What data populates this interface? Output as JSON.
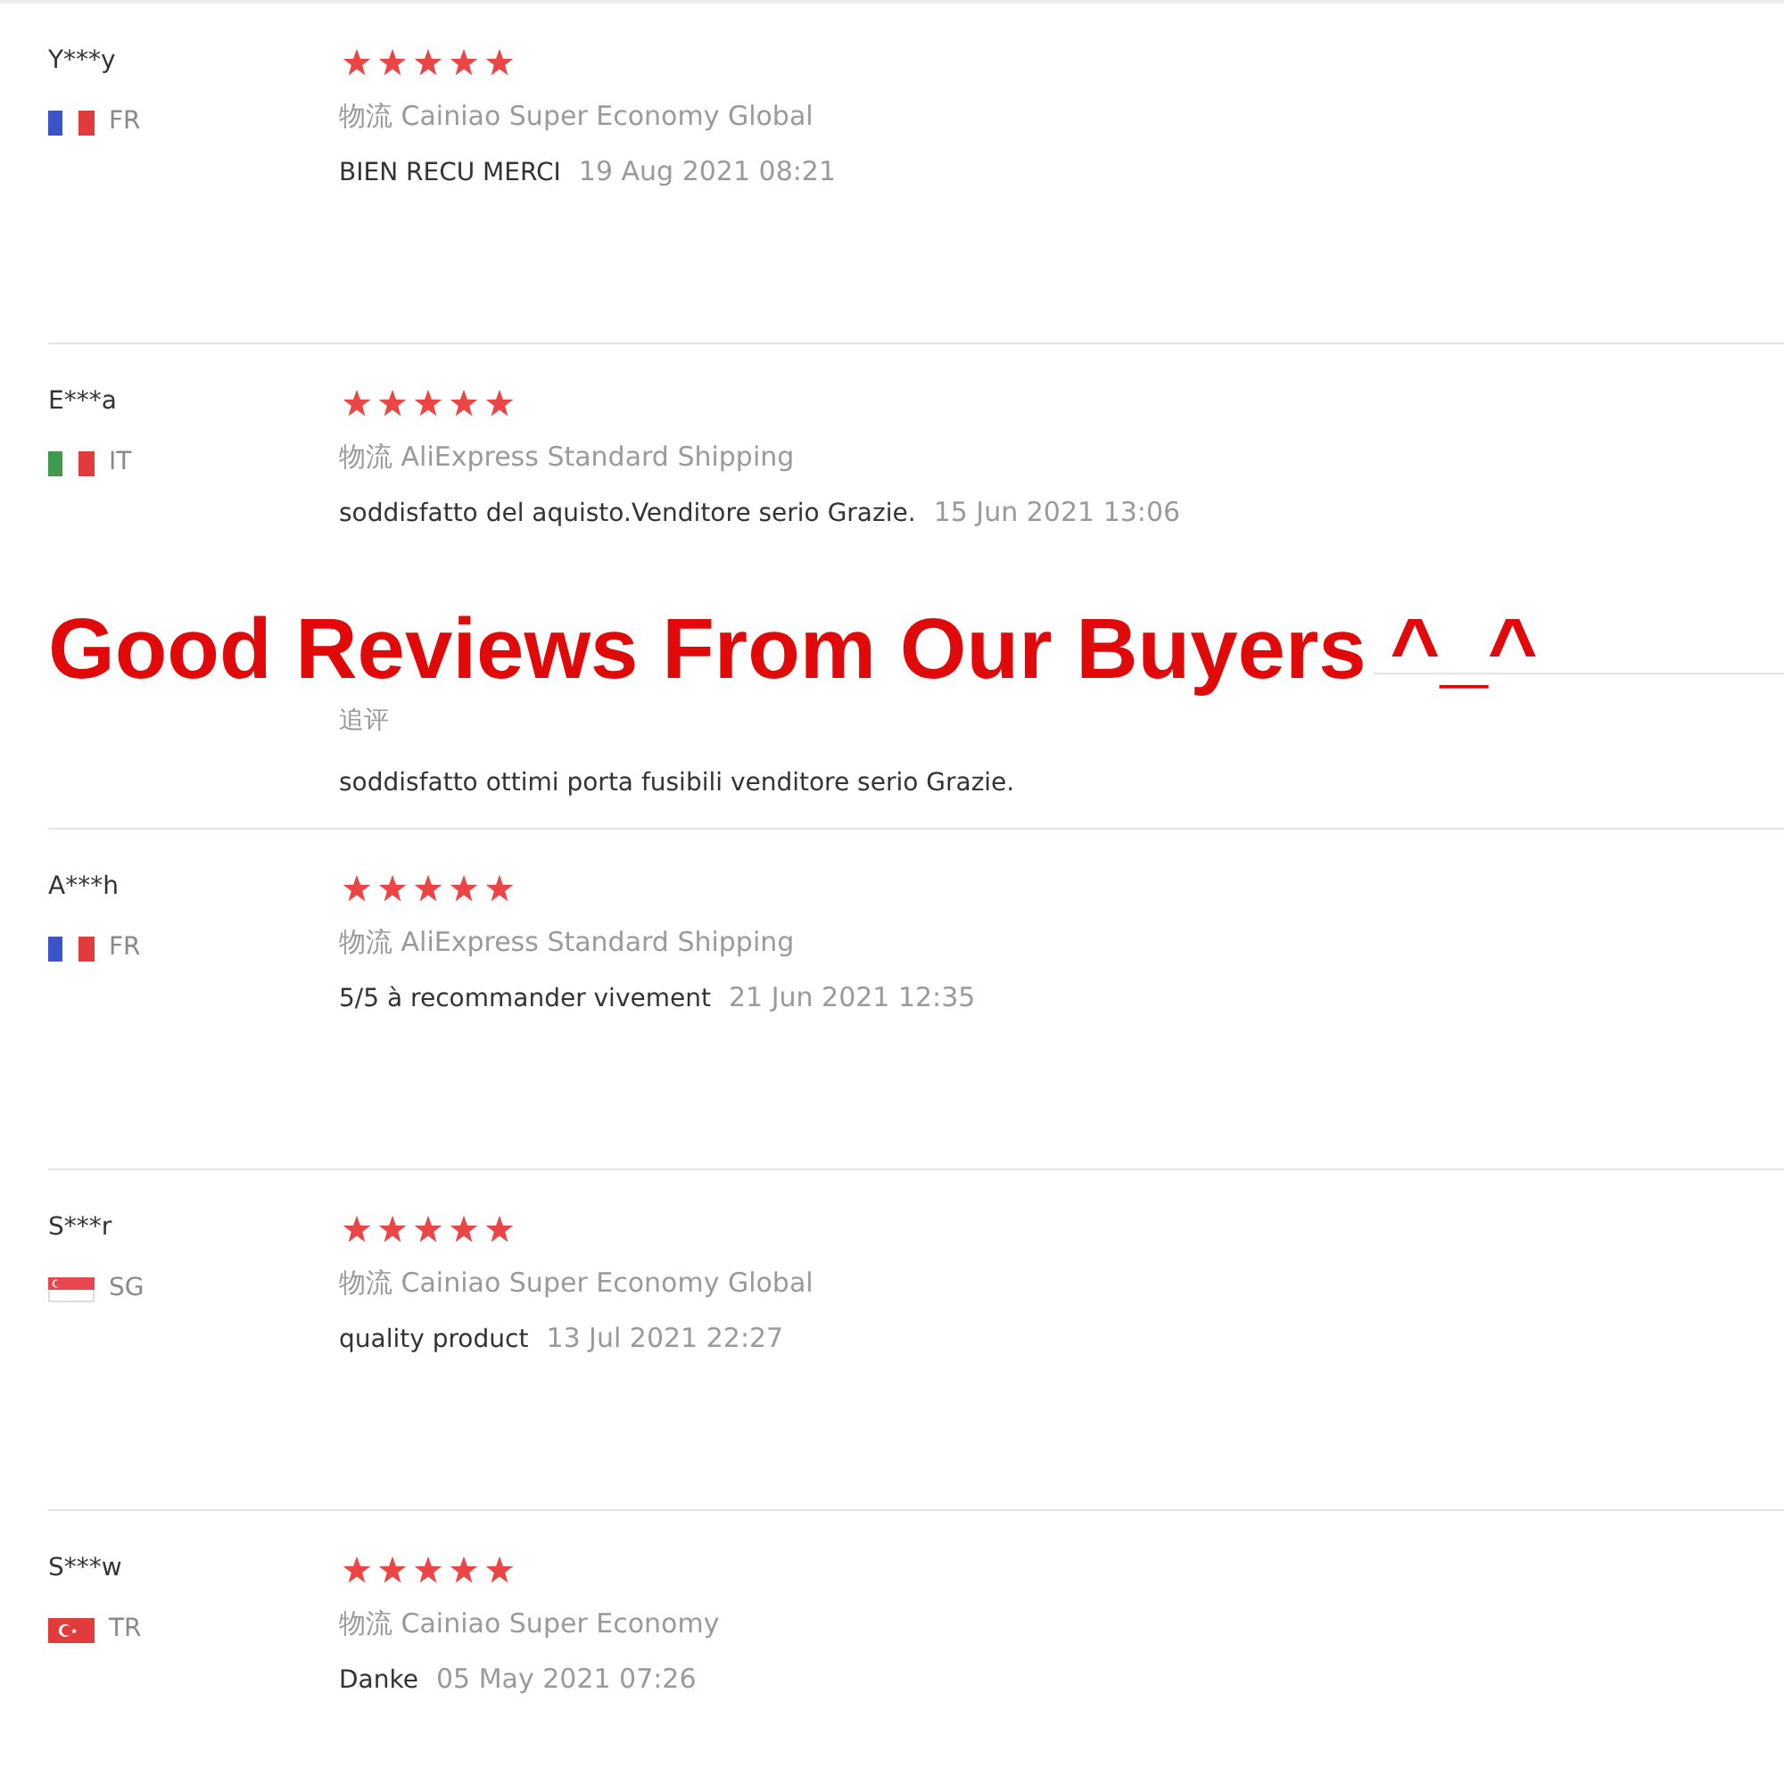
{
  "reviews": [
    {
      "name": "Y***y",
      "flag": {
        "kind": "france"
      },
      "country": "FR",
      "stars": 5,
      "shipping": "物流 Cainiao Super Economy Global",
      "comment": "BIEN RECU MERCI",
      "date": "19 Aug 2021 08:21"
    },
    {
      "name": "E***a",
      "flag": {
        "kind": "italy"
      },
      "country": "IT",
      "stars": 5,
      "shipping": "物流 AliExpress Standard Shipping",
      "comment": "soddisfatto del aquisto.Venditore serio Grazie.",
      "date": "15 Jun 2021 13:06",
      "follow_up": {
        "label": "追评",
        "comment": "soddisfatto ottimi porta fusibili venditore serio Grazie."
      }
    },
    {
      "name": "A***h",
      "flag": {
        "kind": "france"
      },
      "country": "FR",
      "stars": 5,
      "shipping": "物流 AliExpress Standard Shipping",
      "comment": "5/5 à recommander vivement",
      "date": "21 Jun 2021 12:35"
    },
    {
      "name": "S***r",
      "flag": {
        "kind": "singapore"
      },
      "country": "SG",
      "stars": 5,
      "shipping": "物流 Cainiao Super Economy Global",
      "comment": "quality product",
      "date": "13 Jul 2021 22:27"
    },
    {
      "name": "S***w",
      "flag": {
        "kind": "turkey"
      },
      "country": "TR",
      "stars": 5,
      "shipping": "物流 Cainiao Super Economy",
      "comment": "Danke",
      "date": "05 May 2021 07:26"
    }
  ],
  "banner": {
    "title": "Good Reviews From Our Buyers ^_^"
  }
}
